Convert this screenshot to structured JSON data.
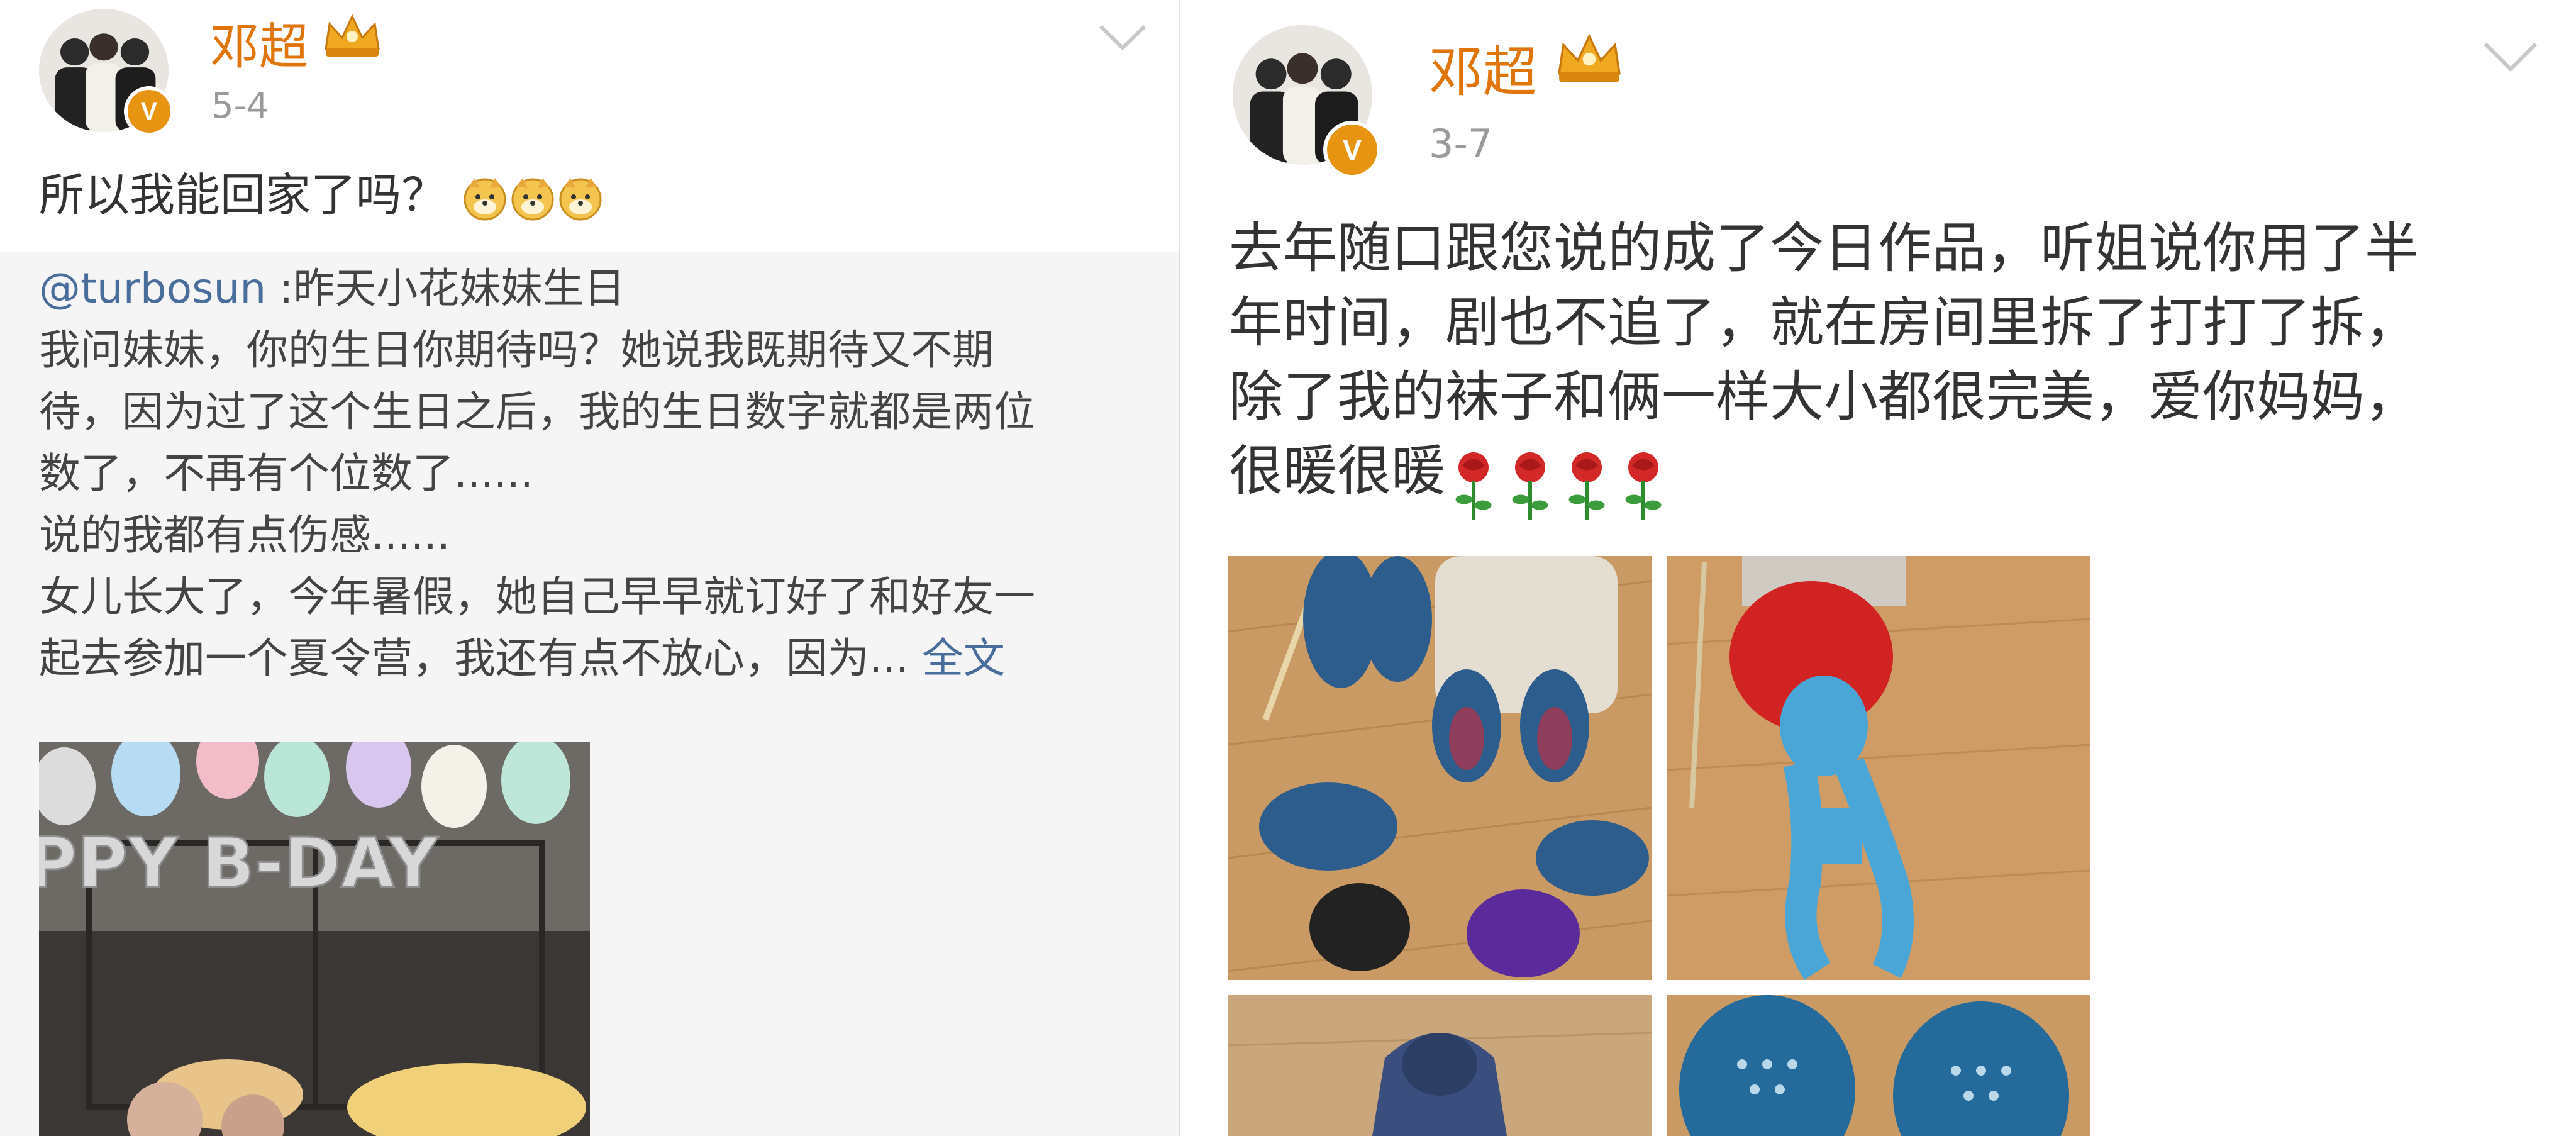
{
  "left_post": {
    "username": "邓超",
    "date": "5-4",
    "text": "所以我能回家了吗？",
    "emoji_names": [
      "doge-emoji",
      "doge-emoji",
      "doge-emoji"
    ],
    "repost": {
      "mention": "@turbosun",
      "lines": [
        " :昨天小花妹妹生日",
        "我问妹妹，你的生日你期待吗？她说我既期待又不期",
        "待，因为过了这个生日之后，我的生日数字就都是两位",
        "数了，不再有个位数了......",
        "说的我都有点伤感......",
        "女儿长大了，今年暑假，她自己早早就订好了和好友一",
        "起去参加一个夏令营，我还有点不放心，因为..."
      ],
      "full_text_link": "全文",
      "image_text": "PPY B-DAY"
    }
  },
  "right_post": {
    "username": "邓超",
    "date": "3-7",
    "lines": [
      "去年随口跟您说的成了今日作品，听姐说你用了半",
      "年时间，剧也不追了，就在房间里拆了打打了拆，",
      "除了我的袜子和俩一样大小都很完美，爱你妈妈，",
      "很暖很暖"
    ],
    "emoji_names": [
      "rose-emoji",
      "rose-emoji",
      "rose-emoji",
      "rose-emoji"
    ],
    "photos": [
      "knitted-slippers-photo",
      "knitted-hat-scarf-photo",
      "knitted-sweater-photo",
      "knitted-socks-photo"
    ]
  },
  "colors": {
    "username": "#e0760b",
    "link": "#4a6e9c",
    "date": "#9a9a9a",
    "verified_badge": "#e89413",
    "repost_bg": "#f5f5f5"
  }
}
